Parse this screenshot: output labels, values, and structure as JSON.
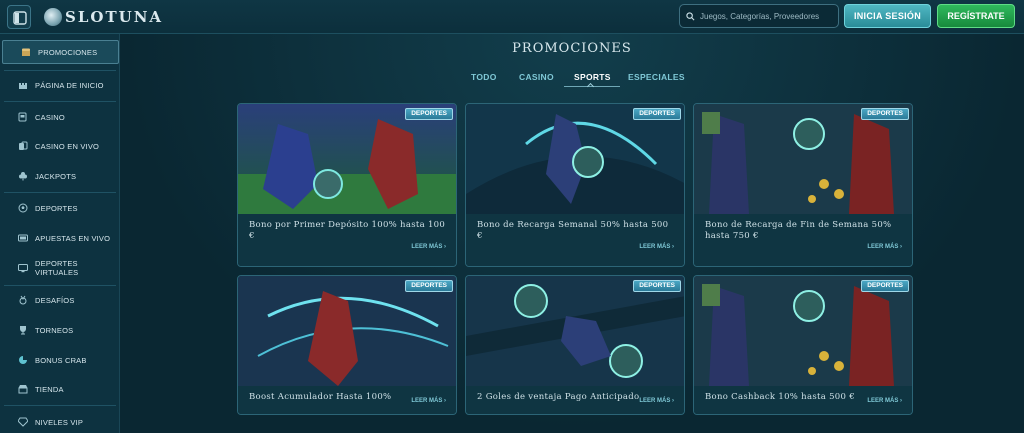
{
  "header": {
    "brand": "SLOTUNA",
    "search_placeholder": "Juegos, Categorías, Proveedores",
    "login_label": "INICIA SESIÓN",
    "register_label": "REGÍSTRATE"
  },
  "sidebar": {
    "items": [
      {
        "label": "PROMOCIONES",
        "icon": "treasure-chest-icon",
        "active": true
      },
      {
        "label": "PÁGINA DE INICIO",
        "icon": "castle-icon"
      },
      {
        "label": "CASINO",
        "icon": "slot-machine-icon"
      },
      {
        "label": "CASINO EN VIVO",
        "icon": "live-cards-icon"
      },
      {
        "label": "JACKPOTS",
        "icon": "clover-icon"
      },
      {
        "label": "DEPORTES",
        "icon": "soccer-ball-icon"
      },
      {
        "label": "APUESTAS EN VIVO",
        "icon": "live-screen-icon"
      },
      {
        "label": "DEPORTES VIRTUALES",
        "icon": "virtual-screen-icon"
      },
      {
        "label": "DESAFÍOS",
        "icon": "medal-icon"
      },
      {
        "label": "TORNEOS",
        "icon": "trophy-icon"
      },
      {
        "label": "BONUS CRAB",
        "icon": "crab-icon"
      },
      {
        "label": "TIENDA",
        "icon": "store-icon"
      },
      {
        "label": "NIVELES VIP",
        "icon": "diamond-icon"
      }
    ]
  },
  "main": {
    "title": "PROMOCIONES",
    "tabs": [
      {
        "label": "TODO"
      },
      {
        "label": "CASINO"
      },
      {
        "label": "SPORTS",
        "active": true
      },
      {
        "label": "ESPECIALES"
      }
    ],
    "cards": [
      {
        "badge": "DEPORTES",
        "title": "Bono por Primer Depósito 100% hasta 100 €",
        "more": "LEER MÁS ›"
      },
      {
        "badge": "DEPORTES",
        "title": "Bono de Recarga Semanal 50% hasta 500 €",
        "more": "LEER MÁS ›"
      },
      {
        "badge": "DEPORTES",
        "title": "Bono de Recarga de Fin de Semana 50% hasta 750 €",
        "more": "LEER MÁS ›"
      },
      {
        "badge": "DEPORTES",
        "title": "Boost Acumulador Hasta 100%",
        "more": "LEER MÁS ›"
      },
      {
        "badge": "DEPORTES",
        "title": "2 Goles de ventaja Pago Anticipado",
        "more": "LEER MÁS ›"
      },
      {
        "badge": "DEPORTES",
        "title": "Bono Cashback 10% hasta 500 €",
        "more": "LEER MÁS ›"
      }
    ]
  },
  "colors": {
    "background": "#0b2a36",
    "accent": "#7fc8d6",
    "login": "#2a8c98",
    "register": "#178a3c"
  }
}
